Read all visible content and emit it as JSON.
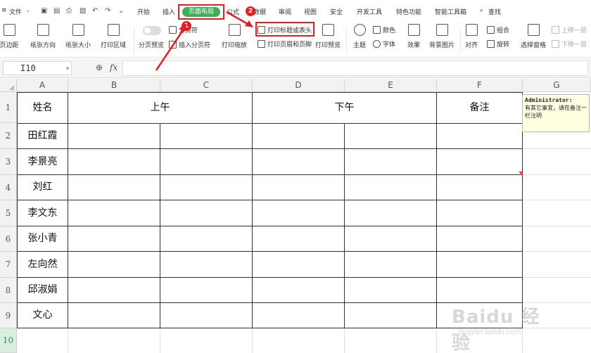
{
  "menubar": {
    "file_label": "文件",
    "tabs": [
      "开始",
      "插入",
      "页面布局",
      "公式",
      "数据",
      "审阅",
      "视图",
      "安全",
      "开发工具",
      "特色功能",
      "智能工具箱"
    ],
    "active_tab": "页面布局",
    "search_label": "查找"
  },
  "ribbon": {
    "margins": "页边距",
    "orientation": "纸张方向",
    "size": "纸张大小",
    "print_area": "打印区域",
    "page_preview": "分页预览",
    "page_break": "分页符",
    "insert_page_break": "插入分页符",
    "print_scale": "打印缩放",
    "print_titles": "打印标题或表头",
    "header_footer": "打印页眉和页脚",
    "print_preview": "打印预览",
    "theme": "主题",
    "colors": "颜色",
    "fonts": "字体",
    "effects": "效果",
    "background": "背景图片",
    "align": "对齐",
    "group": "组合",
    "rotate": "旋转",
    "selection_pane": "选择窗格",
    "bring_forward": "上移一层",
    "send_backward": "下移一层"
  },
  "formula": {
    "cell_ref": "I10",
    "fx": "fx",
    "value": ""
  },
  "sheet": {
    "columns": [
      "A",
      "B",
      "C",
      "D",
      "E",
      "F",
      "G"
    ],
    "rows": [
      "1",
      "2",
      "3",
      "4",
      "5",
      "6",
      "7",
      "8",
      "9",
      "10"
    ],
    "header": {
      "name": "姓名",
      "morning": "上午",
      "afternoon": "下午",
      "remarks": "备注"
    },
    "names": [
      "田红霞",
      "李景亮",
      "刘红",
      "李文东",
      "张小青",
      "左向然",
      "邱淑娟",
      "文心"
    ]
  },
  "comment": {
    "author": "Administrator:",
    "text": "有其它事宜，请在备注一栏注明"
  },
  "annotations": {
    "badge1": "1",
    "badge2": "2"
  },
  "watermark": {
    "main": "Baidu 经验",
    "sub": "jingyan.baidu.com"
  },
  "colors": {
    "accent": "#3fae56",
    "annotation": "#e02020",
    "comment_bg": "#ffffe1"
  }
}
